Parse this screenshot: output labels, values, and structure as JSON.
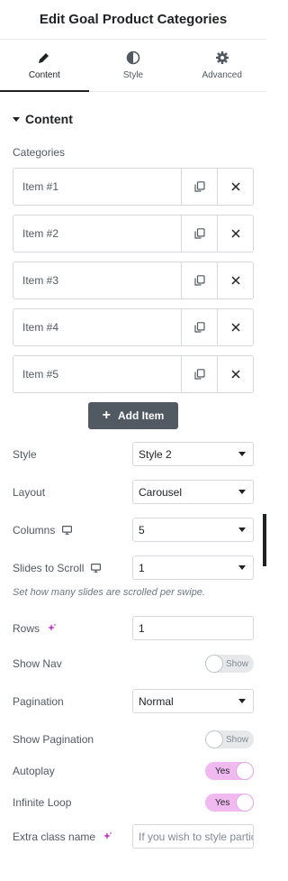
{
  "header": {
    "title": "Edit Goal Product Categories"
  },
  "tabs": [
    {
      "label": "Content",
      "icon": "pencil-icon"
    },
    {
      "label": "Style",
      "icon": "contrast-icon"
    },
    {
      "label": "Advanced",
      "icon": "gear-icon"
    }
  ],
  "section": {
    "title": "Content"
  },
  "categories": {
    "label": "Categories",
    "items": [
      "Item #1",
      "Item #2",
      "Item #3",
      "Item #4",
      "Item #5"
    ],
    "add_label": "Add Item"
  },
  "fields": {
    "style": {
      "label": "Style",
      "value": "Style 2"
    },
    "layout": {
      "label": "Layout",
      "value": "Carousel"
    },
    "columns": {
      "label": "Columns",
      "value": "5"
    },
    "slides": {
      "label": "Slides to Scroll",
      "value": "1",
      "help": "Set how many slides are scrolled per swipe."
    },
    "rows": {
      "label": "Rows",
      "value": "1"
    },
    "show_nav": {
      "label": "Show Nav",
      "state": "Show"
    },
    "pagination": {
      "label": "Pagination",
      "value": "Normal"
    },
    "show_pagination": {
      "label": "Show Pagination",
      "state": "Show"
    },
    "autoplay": {
      "label": "Autoplay",
      "state": "Yes"
    },
    "infinite_loop": {
      "label": "Infinite Loop",
      "state": "Yes"
    },
    "extra_class": {
      "label": "Extra class name",
      "placeholder": "If you wish to style particular"
    }
  },
  "colors": {
    "accent": "#f0b9f0",
    "ai_icon": "#c036c0",
    "button": "#515962"
  }
}
